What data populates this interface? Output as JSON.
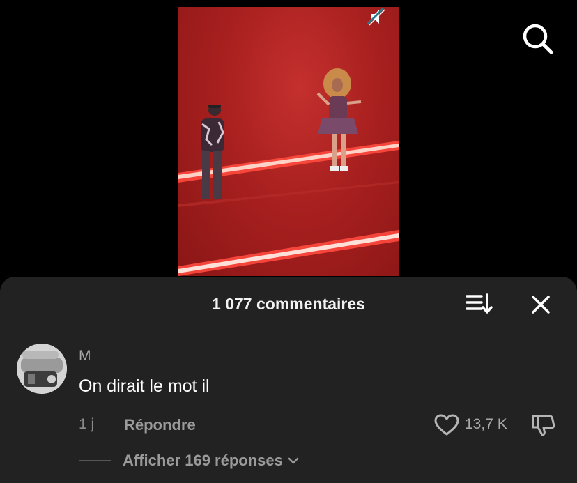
{
  "video": {
    "description_icon": "muted-speaker-icon"
  },
  "header": {
    "search_icon": "search-icon"
  },
  "comments_sheet": {
    "title": "1 077 commentaires",
    "sort_icon": "sort-icon",
    "close_icon": "close-icon"
  },
  "comment": {
    "username": "M",
    "text": "On dirait le mot il",
    "time": "1 j",
    "reply_label": "Répondre",
    "like_count": "13,7 K",
    "view_replies_label": "Afficher 169 réponses"
  },
  "colors": {
    "sheet_bg": "#222222",
    "video_red": "#a8201f"
  }
}
